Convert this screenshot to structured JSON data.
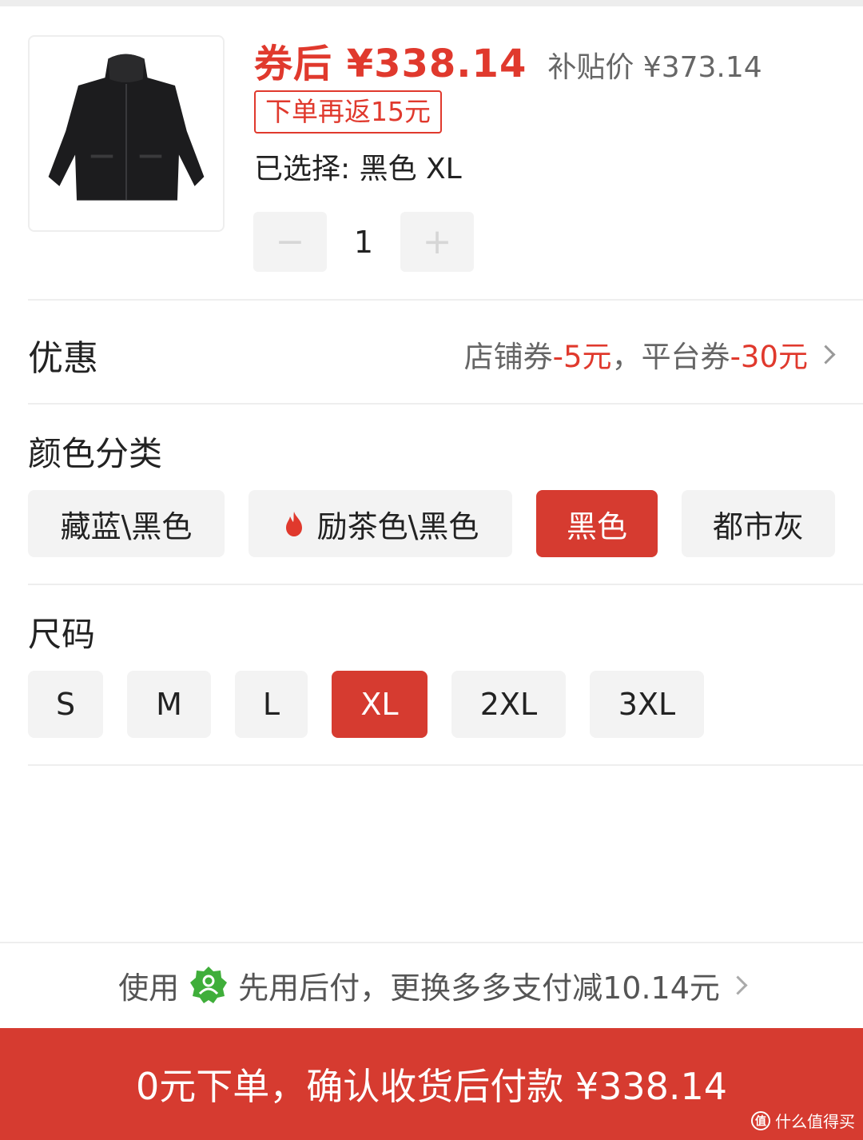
{
  "product": {
    "image_icon": "jacket-thumbnail",
    "price_after_coupon": "券后 ¥338.14",
    "subsidy_price": "补贴价 ¥373.14",
    "rebate_tag": "下单再返15元",
    "selected": "已选择: 黑色 XL",
    "quantity": "1",
    "minus_label": "−",
    "plus_label": "+"
  },
  "discount": {
    "label": "优惠",
    "shop_coupon_label": "店铺券",
    "shop_coupon_value": "-5元",
    "separator": "，",
    "platform_coupon_label": "平台券",
    "platform_coupon_value": "-30元"
  },
  "color": {
    "title": "颜色分类",
    "options": [
      {
        "label": "藏蓝\\黑色",
        "selected": false
      },
      {
        "label": "励茶色\\黑色",
        "selected": false,
        "icon": "flame-icon"
      },
      {
        "label": "黑色",
        "selected": true
      },
      {
        "label": "都市灰",
        "selected": false
      }
    ]
  },
  "size": {
    "title": "尺码",
    "options": [
      {
        "label": "S",
        "selected": false
      },
      {
        "label": "M",
        "selected": false
      },
      {
        "label": "L",
        "selected": false
      },
      {
        "label": "XL",
        "selected": true
      },
      {
        "label": "2XL",
        "selected": false
      },
      {
        "label": "3XL",
        "selected": false
      }
    ]
  },
  "payment": {
    "prefix": "使用",
    "badge_icon": "pay-later-badge-icon",
    "text": "先用后付，更换多多支付减10.14元"
  },
  "cta": {
    "label": "0元下单，确认收货后付款 ¥338.14"
  },
  "watermark": {
    "mark": "值",
    "text": "什么值得买"
  },
  "colors": {
    "accent": "#e0392d",
    "selected_bg": "#d63b30",
    "option_bg": "#f3f3f3",
    "badge_green": "#3fae3a"
  }
}
